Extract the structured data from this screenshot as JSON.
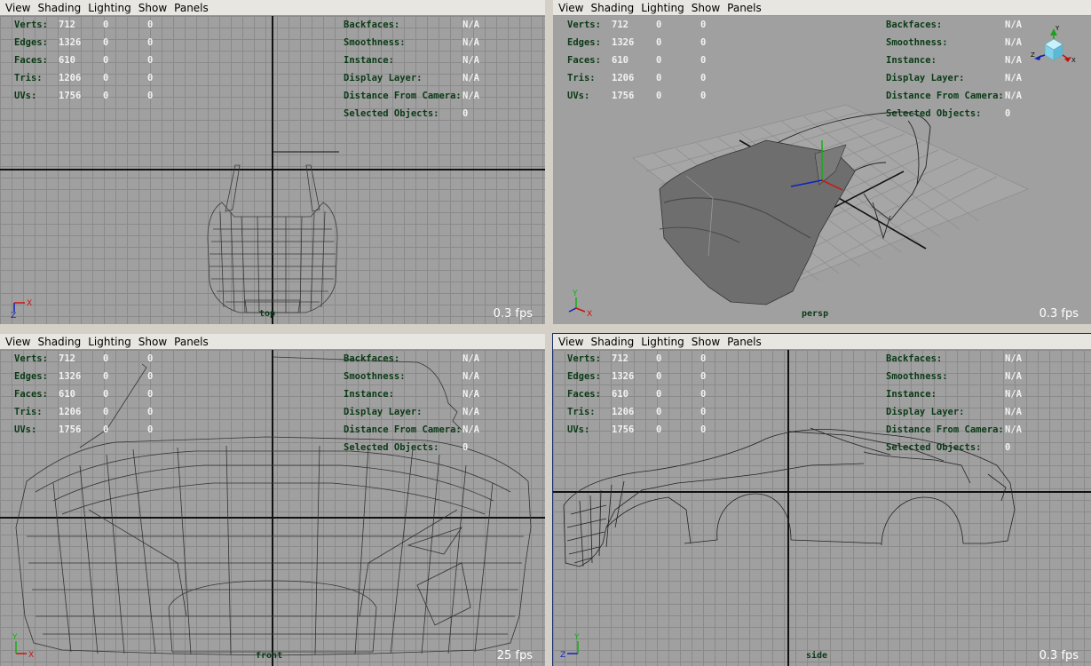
{
  "menu": [
    "View",
    "Shading",
    "Lighting",
    "Show",
    "Panels"
  ],
  "hud": {
    "stats": [
      {
        "label": "Verts:",
        "v1": "712",
        "v2": "0",
        "v3": "0"
      },
      {
        "label": "Edges:",
        "v1": "1326",
        "v2": "0",
        "v3": "0"
      },
      {
        "label": "Faces:",
        "v1": "610",
        "v2": "0",
        "v3": "0"
      },
      {
        "label": "Tris:",
        "v1": "1206",
        "v2": "0",
        "v3": "0"
      },
      {
        "label": "UVs:",
        "v1": "1756",
        "v2": "0",
        "v3": "0"
      }
    ],
    "display": [
      {
        "label": "Backfaces:",
        "value": "N/A"
      },
      {
        "label": "Smoothness:",
        "value": "N/A"
      },
      {
        "label": "Instance:",
        "value": "N/A"
      },
      {
        "label": "Display Layer:",
        "value": "N/A"
      },
      {
        "label": "Distance From Camera:",
        "value": "N/A"
      },
      {
        "label": "Selected Objects:",
        "value": "0"
      }
    ]
  },
  "viewports": {
    "top": {
      "camera": "top",
      "fps": "0.3 fps",
      "axis_h": "X",
      "axis_v": "Z"
    },
    "persp": {
      "camera": "persp",
      "fps": "0.3 fps",
      "axis_h": "X",
      "axis_v": "Y",
      "cube_labels": {
        "y": "Y",
        "x": "X",
        "z": "Z"
      }
    },
    "front": {
      "camera": "front",
      "fps": "25 fps",
      "axis_h": "X",
      "axis_v": "Y"
    },
    "side": {
      "camera": "side",
      "fps": "0.3 fps",
      "axis_h": "Z",
      "axis_v": "Y"
    }
  },
  "colors": {
    "viewport_bg": "#a0a0a0",
    "grid": "#8a8a8a",
    "hud_label": "#0a3a16",
    "hud_value": "#f2f2f2",
    "active_border": "#1a2a6a"
  }
}
